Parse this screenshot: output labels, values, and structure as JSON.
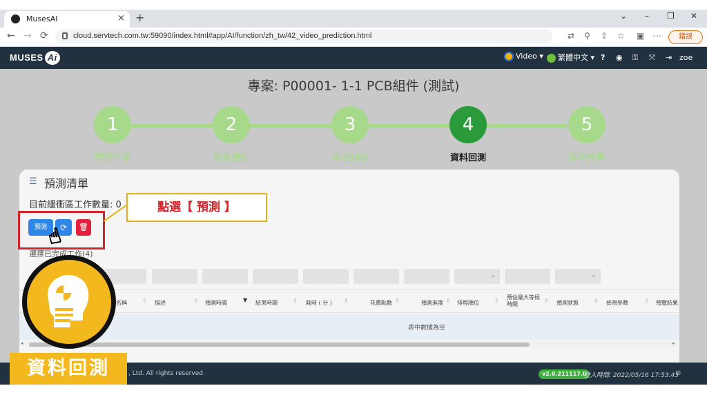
{
  "browser": {
    "tab_title": "MusesAI",
    "tab_close": "×",
    "new_tab": "+",
    "url": "cloud.servtech.com.tw:59090/index.html#app/AI/function/zh_tw/42_video_prediction.html",
    "update_label": "錯誤",
    "win_min": "–",
    "win_max": "❐",
    "win_close": "✕",
    "win_chev": "⌄"
  },
  "app_header": {
    "logo_text": "MUSES",
    "logo_ai": "Ai",
    "video_label": "Video",
    "language_label": "繁體中文",
    "help_icon": "?",
    "user": "zoe"
  },
  "project_title": "專案: P00001- 1-1 PCB組件 (測試)",
  "steps": [
    {
      "number": "1",
      "label": "問題管理"
    },
    {
      "number": "2",
      "label": "影像標記"
    },
    {
      "number": "3",
      "label": "模型訓練"
    },
    {
      "number": "4",
      "label": "資料回測"
    },
    {
      "number": "5",
      "label": "模型佈署"
    }
  ],
  "active_step": 4,
  "card": {
    "title": "預測清單",
    "queue_count": "目前緩衝區工作數量: 0",
    "predict_button": "預測",
    "refresh_icon": "⟳",
    "delete_icon": "🗑",
    "select_hint": "選擇已完成工作(4)",
    "empty_message": "表中數據為空"
  },
  "callout": "點選【 預測 】",
  "table_headers": [
    "名稱",
    "描述",
    "預測時間",
    "結束時間",
    "耗時 ( 分 )",
    "花費點數",
    "預測進度",
    "排程順位",
    "預估最大等候時間",
    "預測狀態",
    "檢視參數",
    "預覽結果"
  ],
  "footer": {
    "copyright": ", Ltd. All rights reserved",
    "version": "v2.0.211117.0",
    "login_time": "登入時間: 2022/05/16 17:53:43"
  },
  "overlay": {
    "label": "資料回測"
  },
  "colors": {
    "step_inactive": "#a6d98a",
    "step_active": "#2b9a3a",
    "header_bg": "#22313f",
    "primary_button": "#2d86e8",
    "danger_button": "#e5203e",
    "highlight_red": "#d3242b",
    "badge_yellow": "#f3b81d"
  }
}
